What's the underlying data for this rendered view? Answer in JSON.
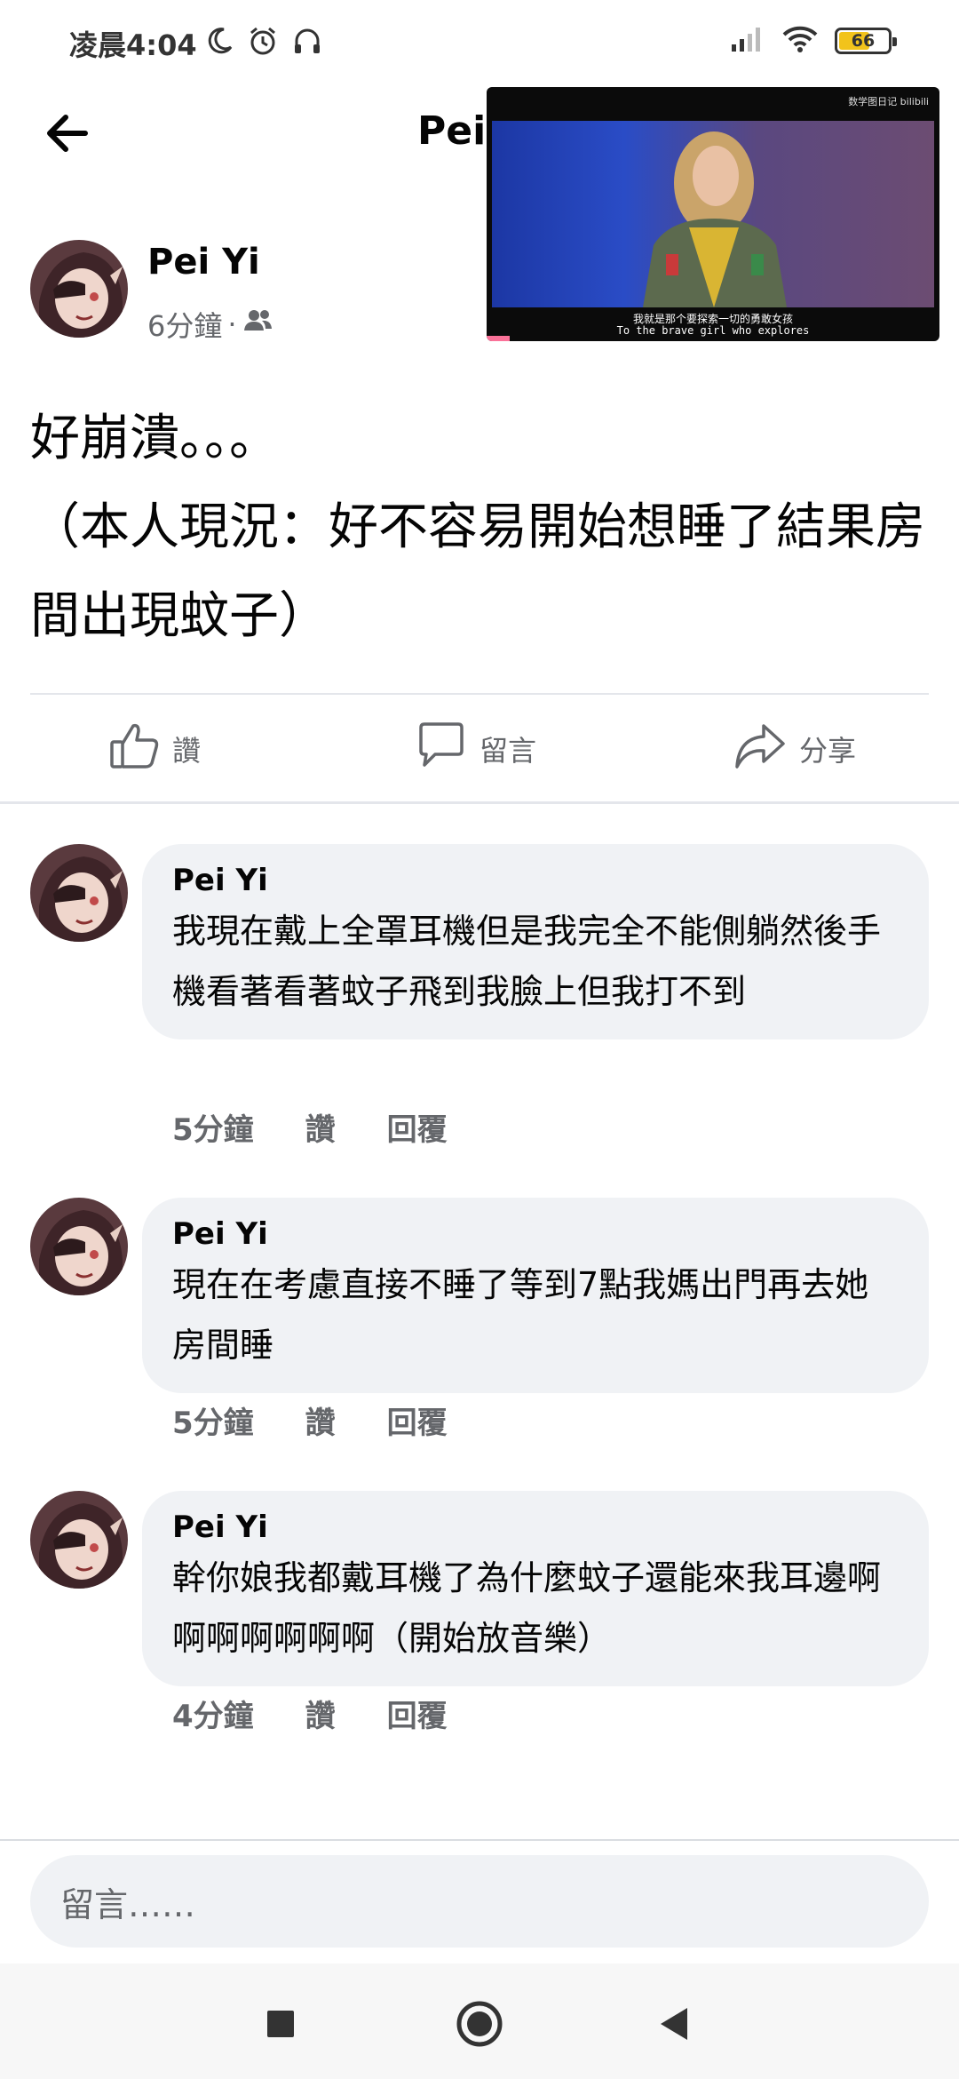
{
  "status_bar": {
    "time": "凌晨4:04",
    "battery": "66",
    "battery_level": 0.66,
    "icons": [
      "moon-icon",
      "alarm-icon",
      "headphones-icon",
      "signal-icon",
      "wifi-icon",
      "battery-icon"
    ]
  },
  "header": {
    "back_icon": "arrow-left-icon",
    "title": "Pei"
  },
  "video": {
    "watermark": "数学图日记 bilibili",
    "subtitle_cn": "我就是那个要探索一切的勇敢女孩",
    "subtitle_en": "To the brave girl who explores",
    "progress": 0.05
  },
  "post": {
    "author": "Pei Yi",
    "time": "6分鐘",
    "separator": "·",
    "audience_icon": "friends-icon",
    "text": "好崩潰。。。\n（本人現況：好不容易開始想睡了結果房間出現蚊子）"
  },
  "actions": {
    "like": "讚",
    "comment": "留言",
    "share": "分享"
  },
  "comments": [
    {
      "author": "Pei Yi",
      "text": "我現在戴上全罩耳機但是我完全不能側躺然後手機看著看著蚊子飛到我臉上但我打不到",
      "time": "5分鐘",
      "like": "讚",
      "reply": "回覆"
    },
    {
      "author": "Pei Yi",
      "text": "現在在考慮直接不睡了等到7點我媽出門再去她房間睡",
      "time": "5分鐘",
      "like": "讚",
      "reply": "回覆"
    },
    {
      "author": "Pei Yi",
      "text": "幹你娘我都戴耳機了為什麼蚊子還能來我耳邊啊啊啊啊啊啊啊（開始放音樂）",
      "time": "4分鐘",
      "like": "讚",
      "reply": "回覆"
    }
  ],
  "composer": {
    "placeholder": "留言……"
  },
  "nav": {
    "recents_icon": "square-icon",
    "home_icon": "circle-icon",
    "back_icon": "triangle-back-icon"
  },
  "colors": {
    "text_primary": "#050505",
    "text_secondary": "#65676b",
    "bubble_bg": "#f0f2f5",
    "divider": "#e4e6eb",
    "battery_fill": "#f2c31b",
    "video_progress": "#fb7299"
  }
}
